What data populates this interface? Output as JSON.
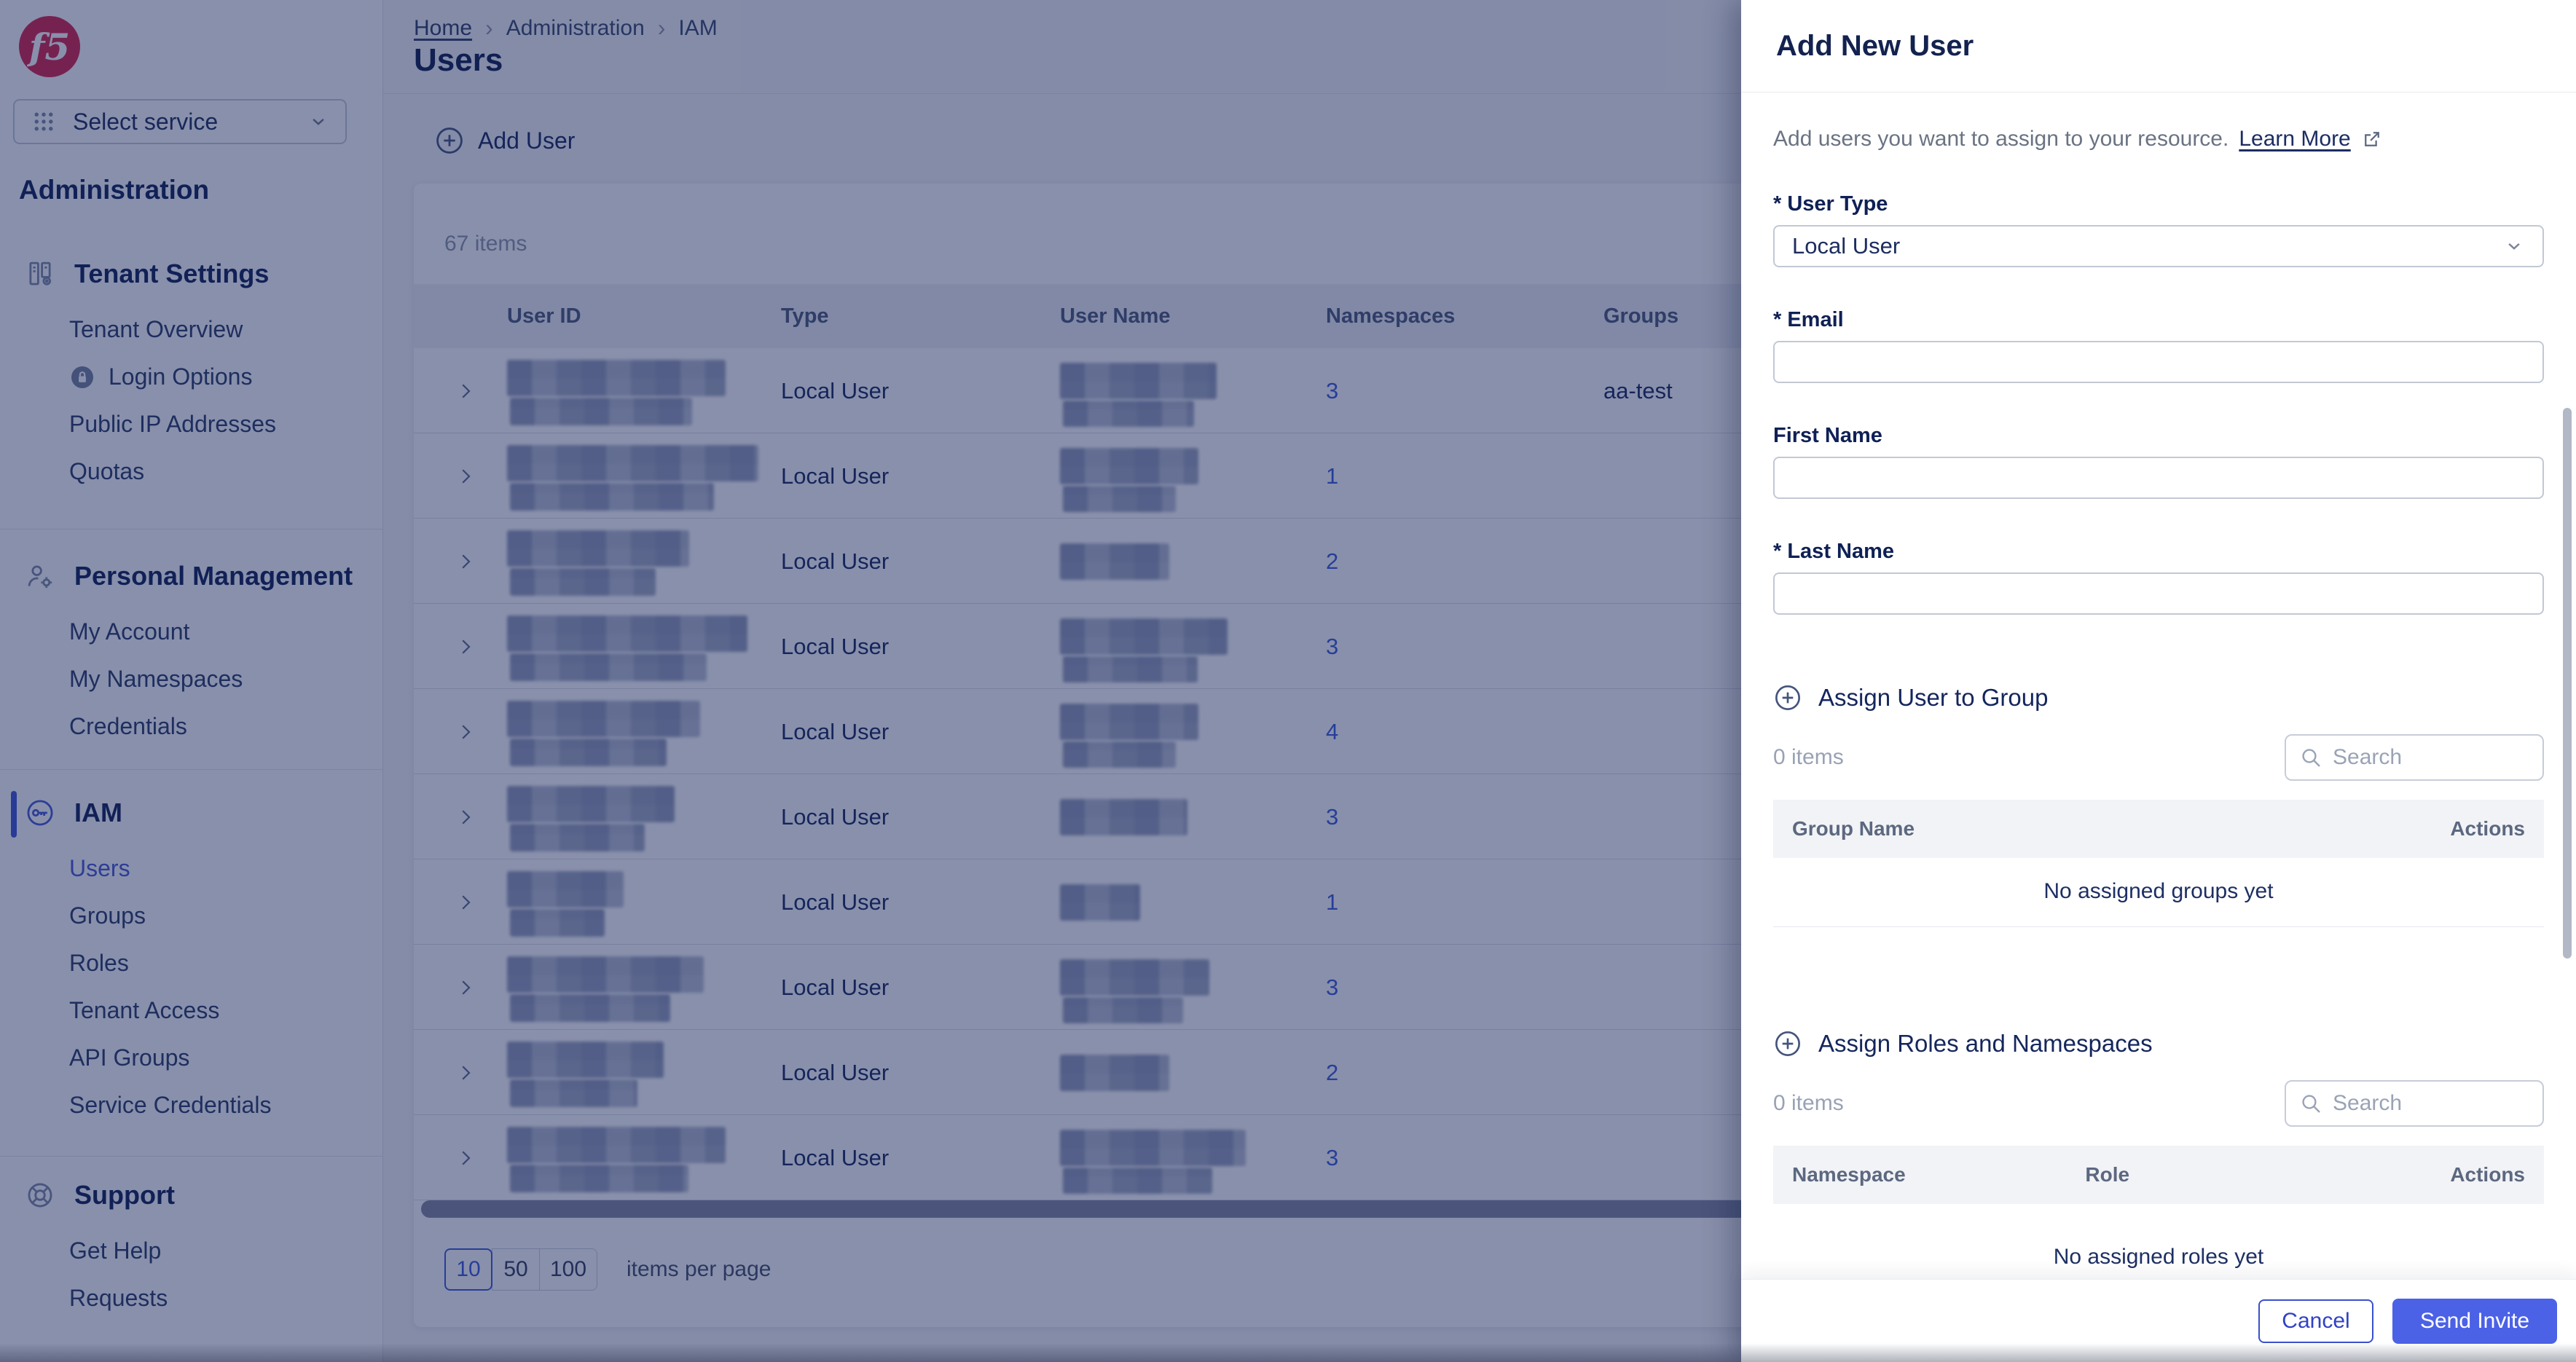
{
  "colors": {
    "accent": "#3f54d6",
    "link": "#3b5bdb",
    "primary_button": "#4b61e6",
    "cancel_border": "#3a50cc",
    "f5_red": "#d9234a",
    "backdrop": "rgba(19,33,88,0.5)",
    "table_header_bg": "#eef1f5",
    "mini_table_header_bg": "#f2f3f6"
  },
  "sidebar": {
    "logo_text": "f5",
    "select_service": "Select service",
    "heading": "Administration",
    "sections": [
      {
        "title": "Tenant Settings",
        "icon": "tenant-settings-icon",
        "items": [
          {
            "label": "Tenant Overview"
          },
          {
            "label": "Login Options",
            "icon": "lock-icon"
          },
          {
            "label": "Public IP Addresses"
          },
          {
            "label": "Quotas"
          }
        ]
      },
      {
        "title": "Personal Management",
        "icon": "person-gear-icon",
        "items": [
          {
            "label": "My Account"
          },
          {
            "label": "My Namespaces"
          },
          {
            "label": "Credentials"
          }
        ]
      },
      {
        "title": "IAM",
        "icon": "key-icon",
        "active": true,
        "items": [
          {
            "label": "Users",
            "active": true
          },
          {
            "label": "Groups"
          },
          {
            "label": "Roles"
          },
          {
            "label": "Tenant Access"
          },
          {
            "label": "API Groups"
          },
          {
            "label": "Service Credentials"
          }
        ]
      },
      {
        "title": "Support",
        "icon": "lifebuoy-icon",
        "items": [
          {
            "label": "Get Help"
          },
          {
            "label": "Requests"
          }
        ]
      }
    ]
  },
  "breadcrumb": {
    "items": [
      "Home",
      "Administration",
      "IAM"
    ],
    "separator": "›"
  },
  "page": {
    "title": "Users"
  },
  "toolbar": {
    "add_user": "Add User"
  },
  "table": {
    "items_count": "67 items",
    "headers": [
      "User ID",
      "Type",
      "User Name",
      "Namespaces",
      "Groups"
    ],
    "rows": [
      {
        "type": "Local User",
        "namespaces": "3",
        "groups": "aa-test"
      },
      {
        "type": "Local User",
        "namespaces": "1",
        "groups": ""
      },
      {
        "type": "Local User",
        "namespaces": "2",
        "groups": ""
      },
      {
        "type": "Local User",
        "namespaces": "3",
        "groups": ""
      },
      {
        "type": "Local User",
        "namespaces": "4",
        "groups": ""
      },
      {
        "type": "Local User",
        "namespaces": "3",
        "groups": ""
      },
      {
        "type": "Local User",
        "namespaces": "1",
        "groups": ""
      },
      {
        "type": "Local User",
        "namespaces": "3",
        "groups": ""
      },
      {
        "type": "Local User",
        "namespaces": "2",
        "groups": ""
      },
      {
        "type": "Local User",
        "namespaces": "3",
        "groups": ""
      }
    ]
  },
  "pagination": {
    "options": [
      "10",
      "50",
      "100"
    ],
    "selected": "10",
    "label": "items per page"
  },
  "panel": {
    "title": "Add New User",
    "description": "Add users you want to assign to your resource.",
    "learn_more": "Learn More",
    "fields": {
      "user_type_label": "* User Type",
      "user_type_value": "Local User",
      "email_label": "* Email",
      "first_name_label": "First Name",
      "last_name_label": "* Last Name"
    },
    "groups_section": {
      "title": "Assign User to Group",
      "items_count": "0 items",
      "search_placeholder": "Search",
      "headers": [
        "Group Name",
        "Actions"
      ],
      "empty": "No assigned groups yet"
    },
    "roles_section": {
      "title": "Assign Roles and Namespaces",
      "items_count": "0 items",
      "search_placeholder": "Search",
      "headers": [
        "Namespace",
        "Role",
        "Actions"
      ],
      "empty": "No assigned roles yet"
    },
    "footer": {
      "cancel": "Cancel",
      "send_invite": "Send Invite"
    }
  }
}
